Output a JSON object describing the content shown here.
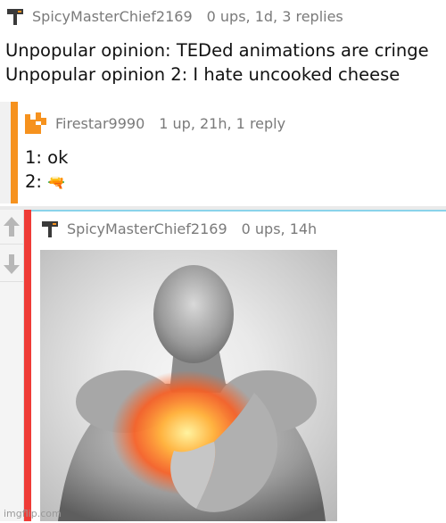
{
  "comments": [
    {
      "username": "SpicyMasterChief2169",
      "stats": "0 ups, 1d, 3 replies",
      "lines": [
        "Unpopular opinion: TEDed animations are cringe",
        "Unpopular opinion 2: I hate uncooked cheese"
      ],
      "avatar_icon": "hammer-icon",
      "accent": "#4a4a4a"
    },
    {
      "username": "Firestar9990",
      "stats": "1 up, 21h, 1 reply",
      "lines": [
        "1: ok",
        "2: "
      ],
      "avatar_icon": "orange-pixel-avatar",
      "emoji": "🔫",
      "thread_color": "#f6921e"
    },
    {
      "username": "SpicyMasterChief2169",
      "stats": "0 ups, 14h",
      "avatar_icon": "hammer-icon",
      "thread_color": "#ef3b36",
      "image_caption": "heartburn meme"
    }
  ],
  "vote": {
    "up_icon": "arrow-up-icon",
    "down_icon": "arrow-down-icon"
  },
  "watermark": "imgflip.com"
}
